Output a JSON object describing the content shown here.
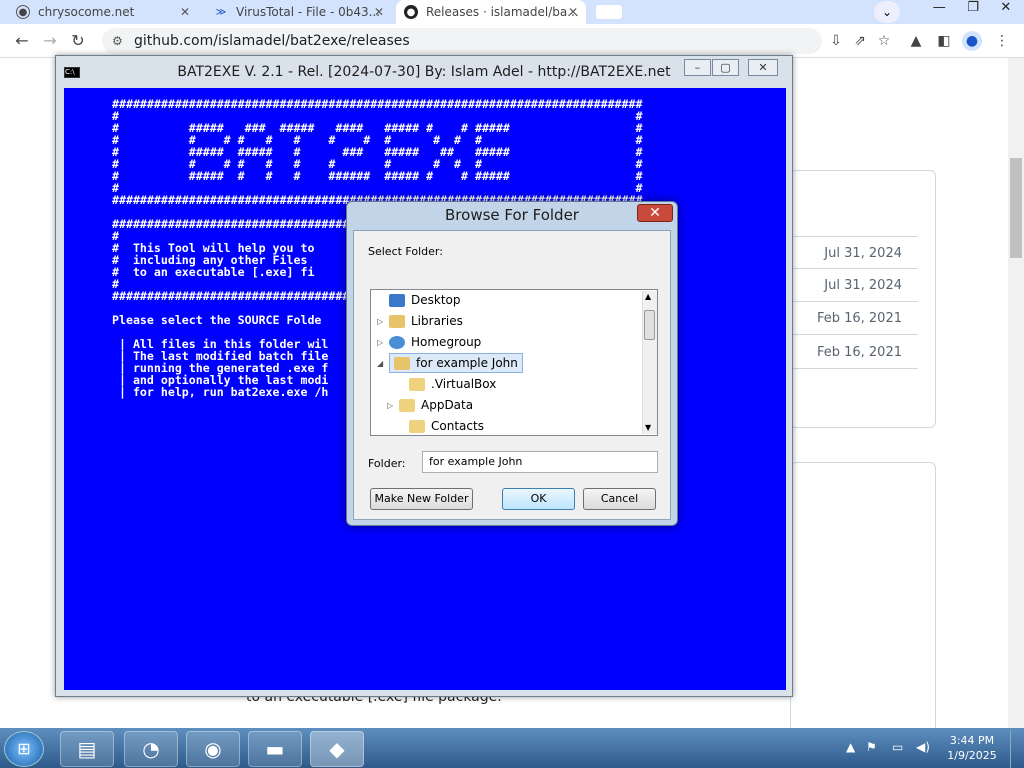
{
  "browser": {
    "tabs": [
      {
        "title": "chrysocome.net",
        "icon": "globe-icon"
      },
      {
        "title": "VirusTotal - File - 0b43...",
        "icon": "virustotal-icon"
      },
      {
        "title": "Releases · islamadel/ba...",
        "icon": "github-icon"
      }
    ],
    "url": "github.com/islamadel/bat2exe/releases"
  },
  "page": {
    "dates": [
      "Jul 31, 2024",
      "Jul 31, 2024",
      "Feb 16, 2021",
      "Feb 16, 2021"
    ],
    "bottom_text": "to an executable [.exe] file package."
  },
  "console": {
    "title": "BAT2EXE V. 2.1 - Rel. [2024-07-30] By: Islam Adel - http://BAT2EXE.net",
    "text": "############################################################################\n#                                                                          #\n#          #####   ###  #####   ####   ##### #    # #####                  #\n#          #    # #   #   #    #    #  #      #  #  #                      #\n#          #####  #####   #      ###   #####   ##   #####                  #\n#          #    # #   #   #    #       #      #  #  #                      #\n#          #####  #   #   #    ######  ##### #    # #####                  #\n#                                                                          #\n############################################################################\n\n####################################\n#\n#  This Tool will help you to\n#  including any other Files\n#  to an executable [.exe] fi\n#\n####################################\n\nPlease select the SOURCE Folde\n\n | All files in this folder wil\n | The last modified batch file\n | running the generated .exe f\n | and optionally the last modi\n | for help, run bat2exe.exe /h"
  },
  "dialog": {
    "title": "Browse For Folder",
    "prompt": "Select Folder:",
    "tree": [
      {
        "label": "Desktop",
        "icon": "desktop-icon"
      },
      {
        "label": "Libraries",
        "icon": "libraries-icon"
      },
      {
        "label": "Homegroup",
        "icon": "homegroup-icon"
      },
      {
        "label": "for example John",
        "icon": "user-folder-icon",
        "selected": true
      },
      {
        "label": ".VirtualBox",
        "icon": "folder-icon"
      },
      {
        "label": "AppData",
        "icon": "folder-icon"
      },
      {
        "label": "Contacts",
        "icon": "folder-icon"
      }
    ],
    "folder_label": "Folder:",
    "folder_value": "for example John",
    "buttons": {
      "new_folder": "Make New Folder",
      "ok": "OK",
      "cancel": "Cancel"
    }
  },
  "taskbar": {
    "time": "3:44 PM",
    "date": "1/9/2025"
  }
}
